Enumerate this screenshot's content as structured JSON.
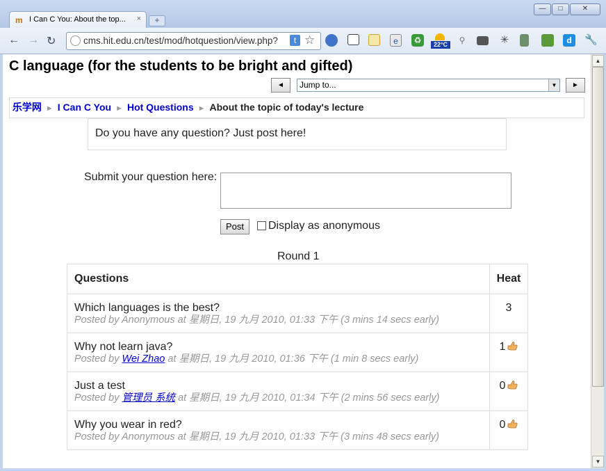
{
  "browser": {
    "tab_title": "I Can C You: About the top...",
    "tab_icon": "moodle-icon",
    "tab_close": "×",
    "new_tab": "+",
    "url": "cms.hit.edu.cn/test/mod/hotquestion/view.php?",
    "url_badge": "t",
    "weather_temp": "22°C",
    "window_buttons": [
      "minimize-icon",
      "maximize-icon",
      "close-icon"
    ]
  },
  "page": {
    "heading": "C language (for the students to be bright and gifted)",
    "jump_label": "Jump to...",
    "prev_arrow": "◄",
    "next_arrow": "►",
    "breadcrumb": {
      "home": "乐学网",
      "course": "I Can C You",
      "module": "Hot Questions",
      "current": "About the topic of today's lecture",
      "separator": "►"
    },
    "intro": "Do you have any question? Just post here!",
    "submit_label": "Submit your question here:",
    "post_button": "Post",
    "anon_label": "Display as anonymous",
    "round": "Round 1",
    "table": {
      "col_questions": "Questions",
      "col_heat": "Heat",
      "rows": [
        {
          "question": "Which languages is the best?",
          "posted_by": "Posted by",
          "author": "Anonymous",
          "author_link": false,
          "at": "at 星期日, 19 九月 2010, 01:33 下午 (3 mins 14 secs early)",
          "heat": "3",
          "vote": false
        },
        {
          "question": "Why not learn java?",
          "posted_by": "Posted by",
          "author": "Wei Zhao",
          "author_link": true,
          "at": "at 星期日, 19 九月 2010, 01:36 下午 (1 min 8 secs early)",
          "heat": "1",
          "vote": true
        },
        {
          "question": "Just a test",
          "posted_by": "Posted by",
          "author": "管理员 系统",
          "author_link": true,
          "at": "at 星期日, 19 九月 2010, 01:34 下午 (2 mins 56 secs early)",
          "heat": "0",
          "vote": true
        },
        {
          "question": "Why you wear in red?",
          "posted_by": "Posted by",
          "author": "Anonymous",
          "author_link": false,
          "at": "at 星期日, 19 九月 2010, 01:33 下午 (3 mins 48 secs early)",
          "heat": "0",
          "vote": true
        }
      ]
    }
  }
}
